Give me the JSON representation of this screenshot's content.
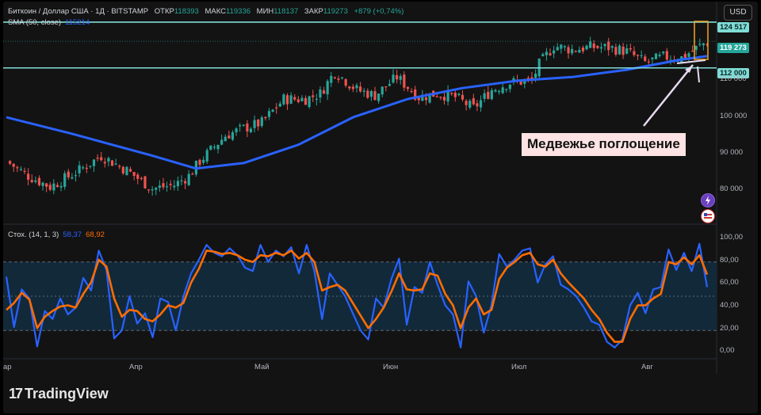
{
  "header": {
    "symbol": "Биткоин / Доллар США · 1Д · BITSTAMP",
    "open_label": "ОТКР",
    "open": "118393",
    "high_label": "МАКС",
    "high": "119336",
    "low_label": "МИН",
    "low": "118137",
    "close_label": "ЗАКР",
    "close": "119273",
    "change": "+879 (+0,74%)",
    "sma_label": "SMA (50, close)",
    "sma_value": "115214",
    "currency_button": "USD"
  },
  "stoch": {
    "label": "Стох. (14, 1, 3)",
    "k_value": "58,37",
    "d_value": "68,92"
  },
  "callout": "Медвежье поглощение",
  "logo": "TradingView",
  "colors": {
    "up": "#26a69a",
    "down": "#ef5350",
    "sma": "#2962ff",
    "k": "#2962ff",
    "d": "#ff6d00",
    "level": "#7fdcd6",
    "box": "#f5a623",
    "callout_bg": "#fde3e3"
  },
  "chart_data": [
    {
      "type": "candlestick",
      "x_labels": [
        "Апр",
        "Май",
        "Июн",
        "Июл",
        "Авг"
      ],
      "x_edge_label": "ар",
      "y_ticks": [
        "110 000",
        "100 000",
        "90 000",
        "80 000"
      ],
      "ylim": [
        70000,
        127000
      ],
      "price_labels": [
        "124 517",
        "119 273",
        "112 000"
      ],
      "levels": [
        124517,
        112000
      ],
      "annotation": "Медвежье поглощение",
      "close_trace": [
        [
          0,
          86500
        ],
        [
          6,
          82500
        ],
        [
          12,
          79500
        ],
        [
          20,
          84000
        ],
        [
          26,
          88000
        ],
        [
          33,
          84000
        ],
        [
          40,
          79000
        ],
        [
          46,
          80000
        ],
        [
          50,
          82500
        ],
        [
          53,
          86500
        ],
        [
          60,
          93500
        ],
        [
          65,
          95500
        ],
        [
          70,
          97000
        ],
        [
          76,
          103500
        ],
        [
          82,
          103500
        ],
        [
          86,
          105000
        ],
        [
          90,
          111000
        ],
        [
          96,
          106000
        ],
        [
          101,
          104500
        ],
        [
          107,
          109500
        ],
        [
          113,
          104000
        ],
        [
          118,
          105000
        ],
        [
          123,
          104000
        ],
        [
          128,
          101000
        ],
        [
          133,
          106000
        ],
        [
          138,
          108000
        ],
        [
          144,
          108500
        ],
        [
          146,
          113000
        ],
        [
          150,
          118000
        ],
        [
          155,
          117000
        ],
        [
          160,
          117700
        ],
        [
          165,
          117600
        ],
        [
          170,
          116500
        ],
        [
          175,
          113500
        ],
        [
          180,
          115000
        ],
        [
          185,
          114800
        ],
        [
          190,
          118000
        ],
        [
          192,
          119273
        ]
      ],
      "sma_trace": [
        [
          0,
          98500
        ],
        [
          18,
          94000
        ],
        [
          40,
          88000
        ],
        [
          52,
          84500
        ],
        [
          65,
          86000
        ],
        [
          80,
          91000
        ],
        [
          95,
          98500
        ],
        [
          110,
          103500
        ],
        [
          125,
          106500
        ],
        [
          140,
          108500
        ],
        [
          155,
          109500
        ],
        [
          170,
          111500
        ],
        [
          185,
          114300
        ],
        [
          192,
          115214
        ]
      ]
    },
    {
      "type": "line",
      "name": "Стох. (14, 1, 3)",
      "y_ticks": [
        "100,00",
        "80,00",
        "60,00",
        "40,00",
        "20,00",
        "0,00"
      ],
      "ylim": [
        0,
        100
      ],
      "band": [
        20,
        80
      ],
      "series": [
        {
          "name": "%K",
          "values": [
            67,
            23,
            56,
            48,
            6,
            37,
            30,
            48,
            34,
            40,
            66,
            55,
            90,
            73,
            13,
            20,
            50,
            26,
            35,
            14,
            48,
            45,
            20,
            50,
            70,
            82,
            95,
            88,
            85,
            92,
            86,
            75,
            72,
            95,
            80,
            90,
            85,
            93,
            70,
            95,
            72,
            30,
            70,
            60,
            50,
            35,
            20,
            12,
            48,
            40,
            65,
            83,
            25,
            58,
            53,
            80,
            60,
            42,
            34,
            5,
            63,
            50,
            18,
            42,
            87,
            76,
            82,
            90,
            92,
            62,
            78,
            85,
            60,
            56,
            50,
            40,
            28,
            25,
            10,
            5,
            12,
            42,
            53,
            35,
            56,
            58,
            91,
            73,
            88,
            72,
            96,
            58
          ]
        },
        {
          "name": "%D",
          "values": [
            38,
            44,
            53,
            47,
            22,
            32,
            37,
            41,
            42,
            40,
            52,
            62,
            82,
            76,
            48,
            32,
            38,
            37,
            30,
            28,
            34,
            42,
            40,
            44,
            62,
            74,
            90,
            89,
            87,
            88,
            86,
            82,
            80,
            86,
            85,
            88,
            86,
            90,
            83,
            88,
            80,
            55,
            58,
            60,
            55,
            44,
            33,
            22,
            30,
            40,
            54,
            70,
            56,
            55,
            56,
            70,
            68,
            52,
            42,
            22,
            40,
            48,
            34,
            38,
            65,
            75,
            80,
            86,
            88,
            78,
            76,
            82,
            70,
            62,
            55,
            48,
            38,
            30,
            18,
            10,
            10,
            30,
            42,
            42,
            48,
            52,
            80,
            78,
            84,
            78,
            86,
            69
          ]
        }
      ]
    }
  ]
}
